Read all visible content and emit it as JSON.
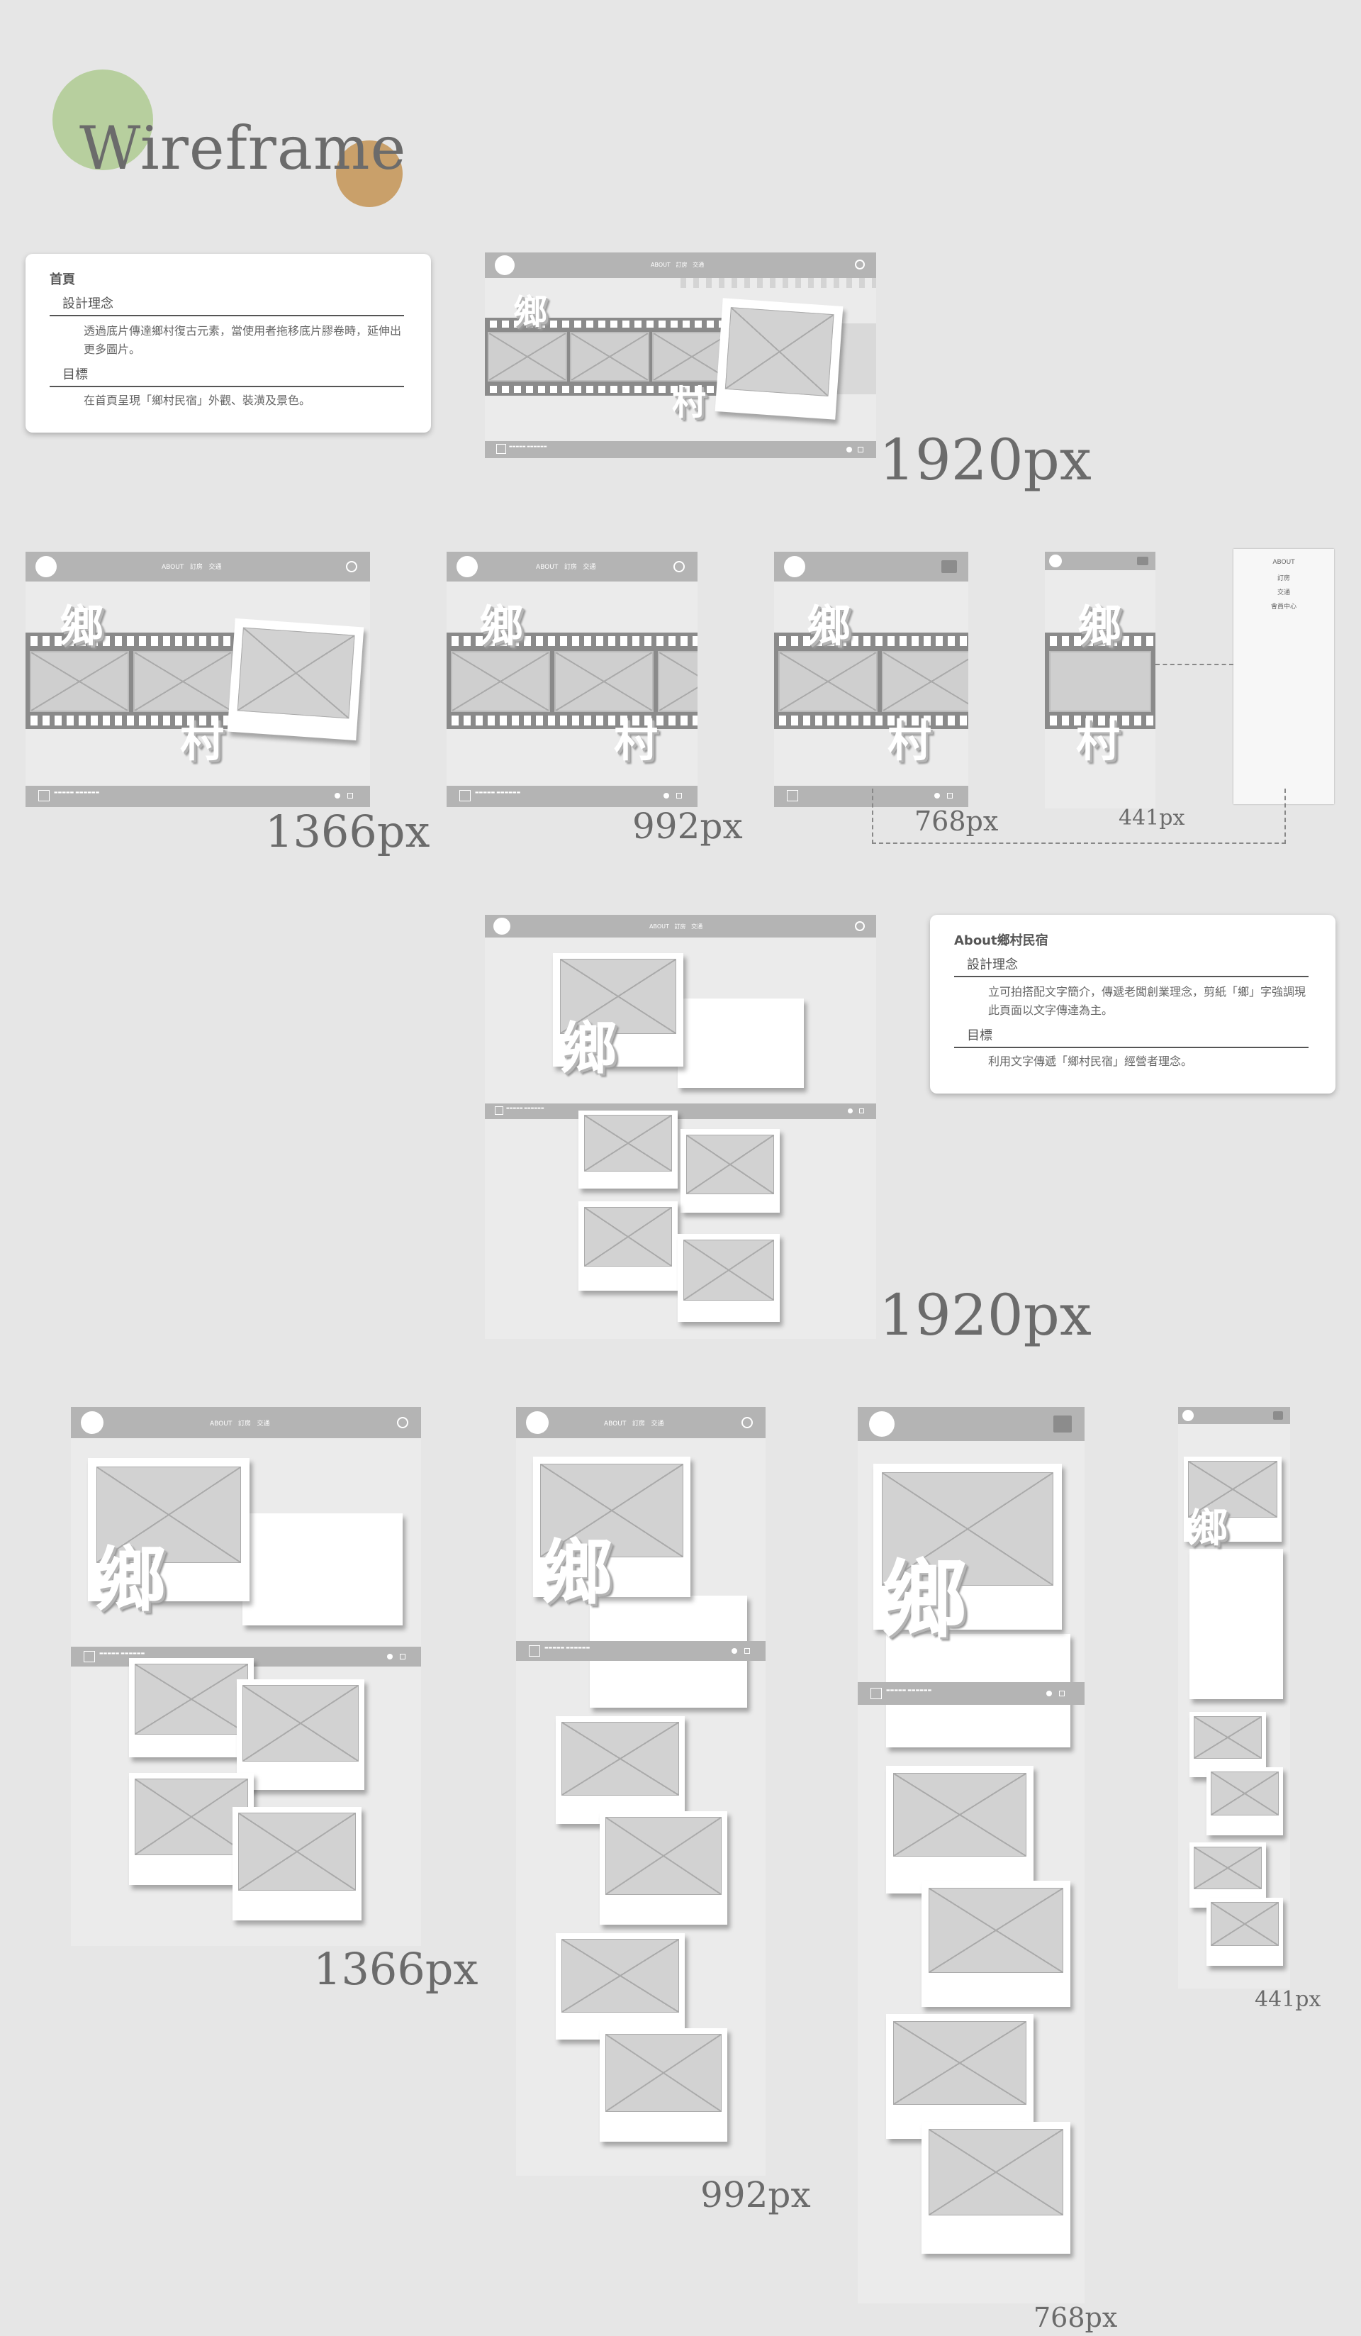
{
  "page_title": "Wireframe",
  "colors": {
    "green_circle": "#b7cf9e",
    "orange_circle": "#c9a06a",
    "background": "#e6e6e6"
  },
  "home_card": {
    "heading": "首頁",
    "concept_label": "設計理念",
    "concept_text": "透過底片傳達鄉村復古元素，當使用者拖移底片膠卷時，延伸出更多圖片。",
    "goal_label": "目標",
    "goal_text": "在首頁呈現「鄉村民宿」外觀、裝潢及景色。"
  },
  "about_card": {
    "heading": "About鄉村民宿",
    "concept_label": "設計理念",
    "concept_text": "立可拍搭配文字簡介，傳遞老闆創業理念，剪紙「鄉」字強調現此頁面以文字傳達為主。",
    "goal_label": "目標",
    "goal_text": "利用文字傳遞「鄉村民宿」經營者理念。"
  },
  "nav": {
    "about": "ABOUT",
    "booking": "訂房",
    "traffic": "交通",
    "member": "會員中心"
  },
  "kanji": {
    "xiang": "鄉",
    "cun": "村"
  },
  "breakpoints": {
    "home_1920": "1920px",
    "home_1366": "1366px",
    "home_992": "992px",
    "home_768": "768px",
    "home_441": "441px",
    "about_1920": "1920px",
    "about_1366": "1366px",
    "about_992": "992px",
    "about_768": "768px",
    "about_441": "441px"
  }
}
